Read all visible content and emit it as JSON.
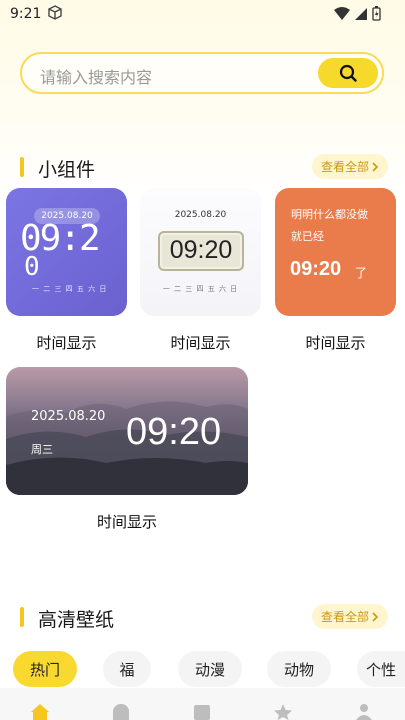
{
  "status_bar": {
    "time": "9:21"
  },
  "search": {
    "placeholder": "请输入搜索内容"
  },
  "widgets_section": {
    "title": "小组件",
    "see_all": "查看全部"
  },
  "widgets": [
    {
      "label": "时间显示",
      "date": "2025.08.20",
      "time": "09:2",
      "time_extra": "0",
      "weekdays": "一 二 三 四 五 六 日"
    },
    {
      "label": "时间显示",
      "date": "2025.08.20",
      "time": "09:20",
      "weekdays": "一 二 三 四 五 六 日"
    },
    {
      "label": "时间显示",
      "line1": "明明什么都没做",
      "line2": "就已经",
      "time": "09:20",
      "suffix": "了"
    },
    {
      "label": "时间显示",
      "date": "2025.08.20",
      "weekday": "周三",
      "time": "09:20"
    }
  ],
  "wallpaper_section": {
    "title": "高清壁纸",
    "see_all": "查看全部"
  },
  "categories": [
    {
      "label": "热门",
      "active": true
    },
    {
      "label": "福",
      "active": false
    },
    {
      "label": "动漫",
      "active": false
    },
    {
      "label": "动物",
      "active": false
    },
    {
      "label": "个性",
      "active": false
    }
  ],
  "colors": {
    "accent": "#f9d830",
    "widget_purple": "#6a61cf",
    "widget_orange": "#ea7b4a"
  }
}
